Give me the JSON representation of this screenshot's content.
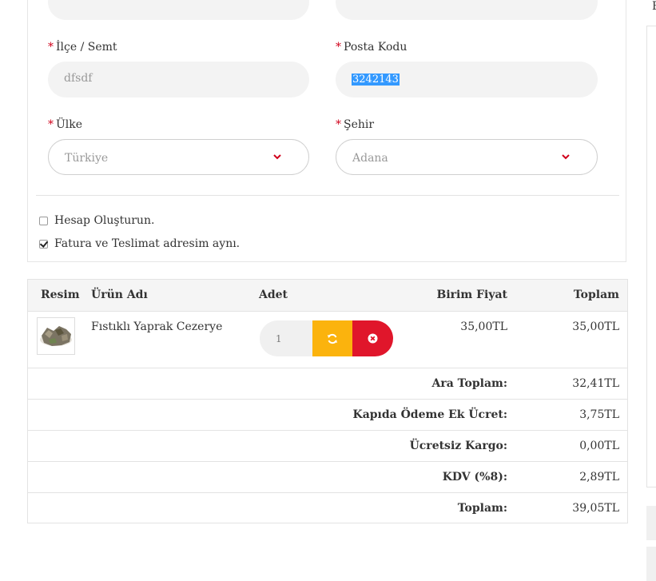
{
  "form": {
    "district": {
      "label": "İlçe / Semt",
      "required_mark": "*",
      "value": "dfsdf"
    },
    "postal_code": {
      "label": "Posta Kodu",
      "required_mark": "*",
      "value": "3242143"
    },
    "country": {
      "label": "Ülke",
      "required_mark": "*",
      "value": "Türkiye"
    },
    "city": {
      "label": "Şehir",
      "required_mark": "*",
      "value": "Adana"
    },
    "create_account": {
      "label": "Hesap Oluşturun.",
      "checked": false
    },
    "same_address": {
      "label": "Fatura ve Teslimat adresim aynı.",
      "checked": true
    }
  },
  "cart": {
    "headers": {
      "image": "Resim",
      "product": "Ürün Adı",
      "quantity": "Adet",
      "unit_price": "Birim Fiyat",
      "total": "Toplam"
    },
    "items": [
      {
        "name": "Fıstıklı Yaprak Cezerye",
        "quantity": "1",
        "unit_price": "35,00TL",
        "total": "35,00TL"
      }
    ],
    "summary": [
      {
        "label": "Ara Toplam:",
        "value": "32,41TL"
      },
      {
        "label": "Kapıda Ödeme Ek Ücret:",
        "value": "3,75TL"
      },
      {
        "label": "Ücretsiz Kargo:",
        "value": "0,00TL"
      },
      {
        "label": "KDV (%8):",
        "value": "2,89TL"
      },
      {
        "label": "Toplam:",
        "value": "39,05TL"
      }
    ]
  },
  "colors": {
    "required": "#d0021b",
    "refresh_button": "#fbb30d",
    "remove_button": "#e0162b",
    "selection": "#3399ff"
  },
  "icons": {
    "refresh": "refresh-icon",
    "remove": "close-circle-icon",
    "chevron": "chevron-down-icon"
  }
}
